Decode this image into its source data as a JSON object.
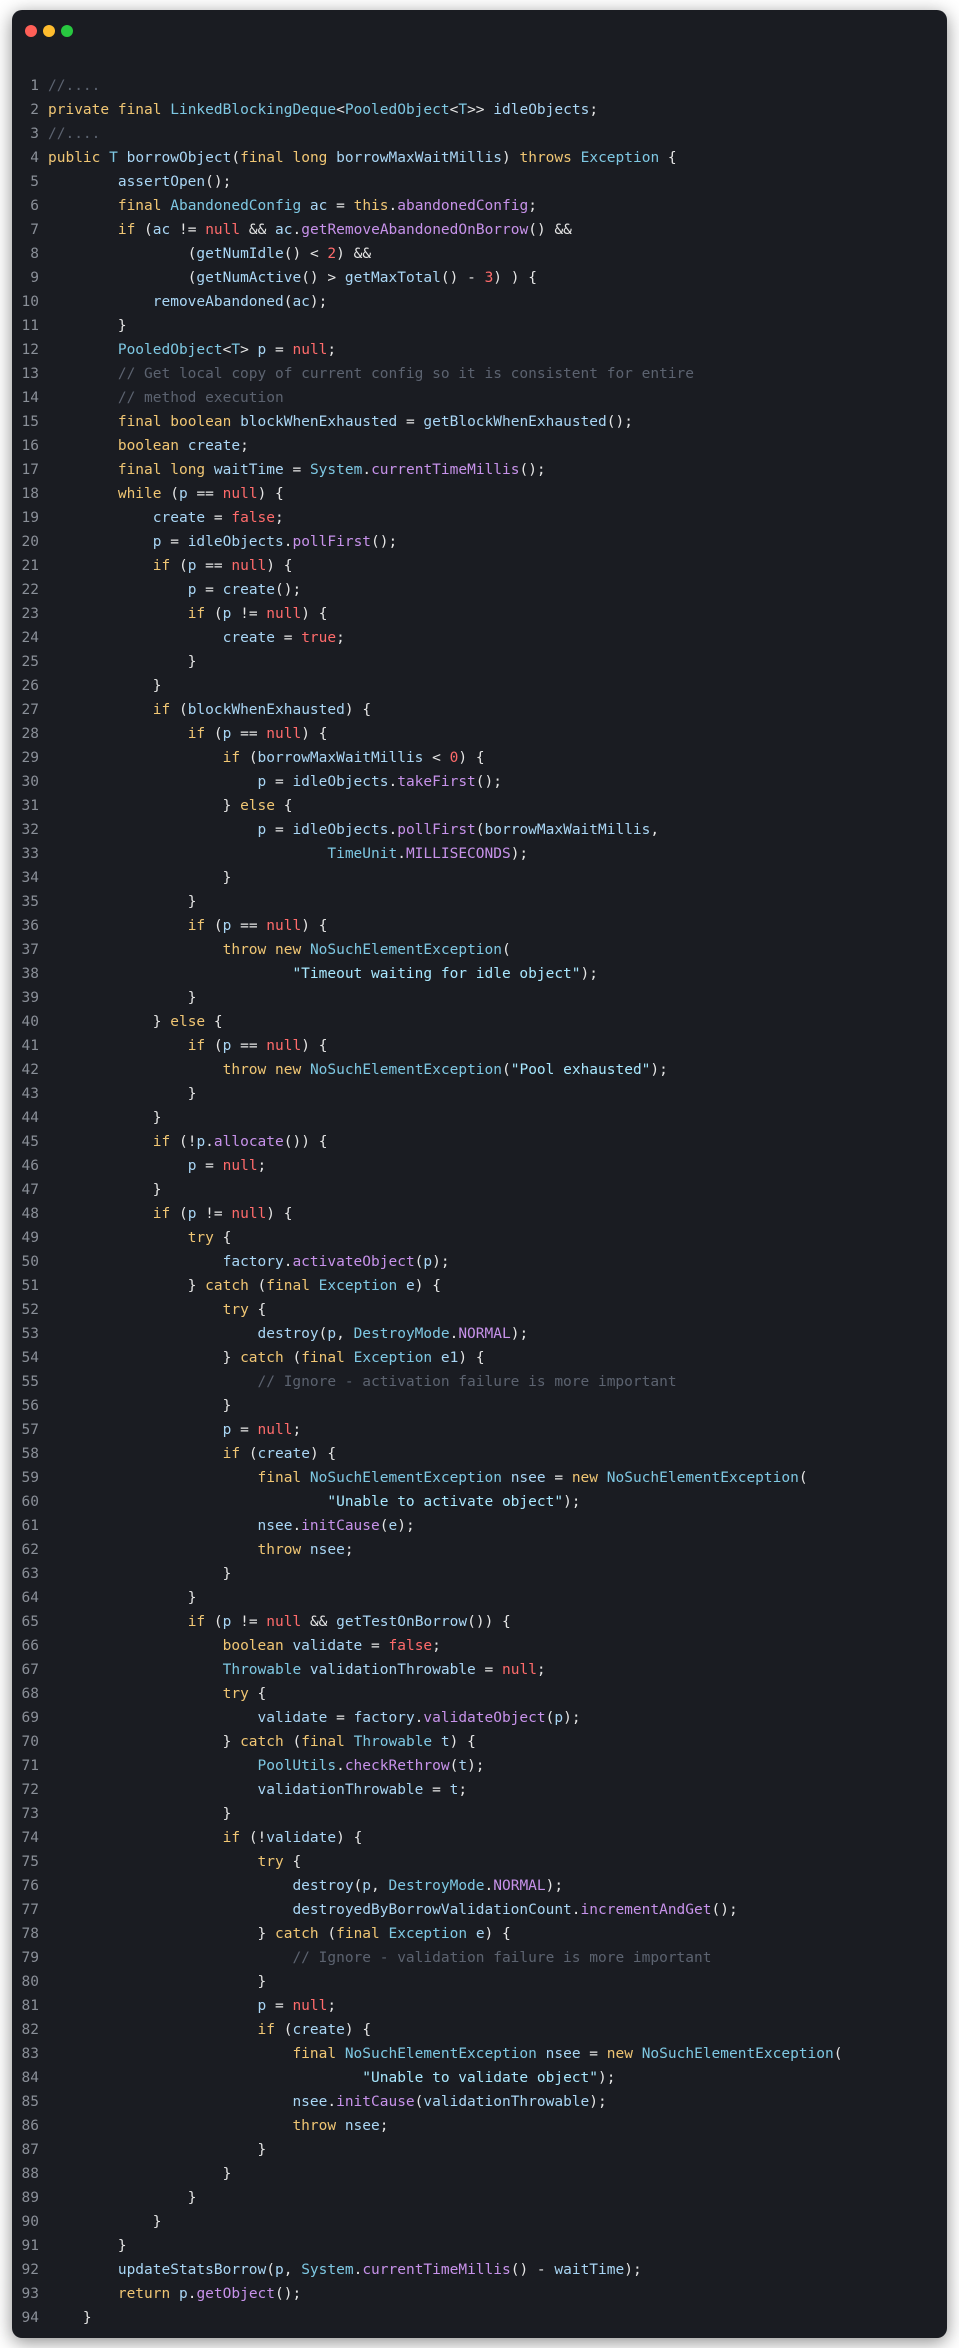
{
  "window": {
    "controls": [
      "close",
      "minimize",
      "zoom"
    ],
    "colors": {
      "background": "#1a1c22",
      "close": "#ff5f57",
      "minimize": "#febc2e",
      "zoom": "#28c840"
    }
  },
  "code": {
    "lines": [
      "//....",
      "private final LinkedBlockingDeque<PooledObject<T>> idleObjects;",
      "//....",
      "public T borrowObject(final long borrowMaxWaitMillis) throws Exception {",
      "        assertOpen();",
      "        final AbandonedConfig ac = this.abandonedConfig;",
      "        if (ac != null && ac.getRemoveAbandonedOnBorrow() &&",
      "                (getNumIdle() < 2) &&",
      "                (getNumActive() > getMaxTotal() - 3) ) {",
      "            removeAbandoned(ac);",
      "        }",
      "        PooledObject<T> p = null;",
      "        // Get local copy of current config so it is consistent for entire",
      "        // method execution",
      "        final boolean blockWhenExhausted = getBlockWhenExhausted();",
      "        boolean create;",
      "        final long waitTime = System.currentTimeMillis();",
      "        while (p == null) {",
      "            create = false;",
      "            p = idleObjects.pollFirst();",
      "            if (p == null) {",
      "                p = create();",
      "                if (p != null) {",
      "                    create = true;",
      "                }",
      "            }",
      "            if (blockWhenExhausted) {",
      "                if (p == null) {",
      "                    if (borrowMaxWaitMillis < 0) {",
      "                        p = idleObjects.takeFirst();",
      "                    } else {",
      "                        p = idleObjects.pollFirst(borrowMaxWaitMillis,",
      "                                TimeUnit.MILLISECONDS);",
      "                    }",
      "                }",
      "                if (p == null) {",
      "                    throw new NoSuchElementException(",
      "                            \"Timeout waiting for idle object\");",
      "                }",
      "            } else {",
      "                if (p == null) {",
      "                    throw new NoSuchElementException(\"Pool exhausted\");",
      "                }",
      "            }",
      "            if (!p.allocate()) {",
      "                p = null;",
      "            }",
      "            if (p != null) {",
      "                try {",
      "                    factory.activateObject(p);",
      "                } catch (final Exception e) {",
      "                    try {",
      "                        destroy(p, DestroyMode.NORMAL);",
      "                    } catch (final Exception e1) {",
      "                        // Ignore - activation failure is more important",
      "                    }",
      "                    p = null;",
      "                    if (create) {",
      "                        final NoSuchElementException nsee = new NoSuchElementException(",
      "                                \"Unable to activate object\");",
      "                        nsee.initCause(e);",
      "                        throw nsee;",
      "                    }",
      "                }",
      "                if (p != null && getTestOnBorrow()) {",
      "                    boolean validate = false;",
      "                    Throwable validationThrowable = null;",
      "                    try {",
      "                        validate = factory.validateObject(p);",
      "                    } catch (final Throwable t) {",
      "                        PoolUtils.checkRethrow(t);",
      "                        validationThrowable = t;",
      "                    }",
      "                    if (!validate) {",
      "                        try {",
      "                            destroy(p, DestroyMode.NORMAL);",
      "                            destroyedByBorrowValidationCount.incrementAndGet();",
      "                        } catch (final Exception e) {",
      "                            // Ignore - validation failure is more important",
      "                        }",
      "                        p = null;",
      "                        if (create) {",
      "                            final NoSuchElementException nsee = new NoSuchElementException(",
      "                                    \"Unable to validate object\");",
      "                            nsee.initCause(validationThrowable);",
      "                            throw nsee;",
      "                        }",
      "                    }",
      "                }",
      "            }",
      "        }",
      "        updateStatsBorrow(p, System.currentTimeMillis() - waitTime);",
      "        return p.getObject();",
      "    }"
    ]
  }
}
